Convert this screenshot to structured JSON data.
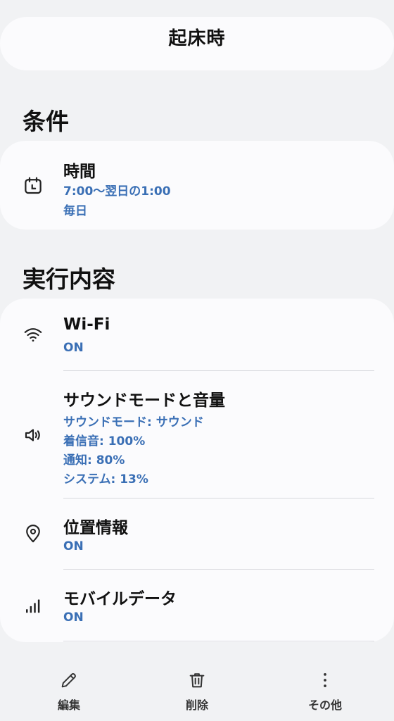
{
  "header": {
    "title": "起床時"
  },
  "conditions": {
    "heading": "条件",
    "items": [
      {
        "icon": "calendar-clock-icon",
        "label": "時間",
        "details": [
          "7:00〜翌日の1:00",
          "毎日"
        ]
      }
    ]
  },
  "actions": {
    "heading": "実行内容",
    "items": [
      {
        "icon": "wifi-icon",
        "label": "Wi-Fi",
        "details": [
          "ON"
        ]
      },
      {
        "icon": "speaker-icon",
        "label": "サウンドモードと音量",
        "details": [
          "サウンドモード: サウンド",
          "着信音: 100%",
          "通知: 80%",
          "システム: 13%"
        ]
      },
      {
        "icon": "location-pin-icon",
        "label": "位置情報",
        "details": [
          "ON"
        ]
      },
      {
        "icon": "signal-bars-icon",
        "label": "モバイルデータ",
        "details": [
          "ON"
        ]
      }
    ]
  },
  "toolbar": {
    "edit_label": "編集",
    "delete_label": "削除",
    "more_label": "その他"
  },
  "colors": {
    "accent": "#3a6fb5",
    "background": "#f1f2f4",
    "card": "#fbfbfd"
  }
}
